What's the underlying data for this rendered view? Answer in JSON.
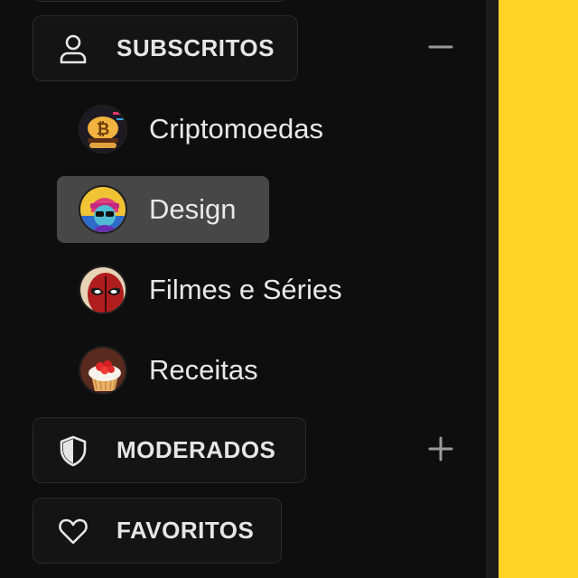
{
  "sections": {
    "subscritos": {
      "label": "SUBSCRITOS",
      "icon": "user-icon",
      "toggle_icon": "minus-icon"
    },
    "moderados": {
      "label": "MODERADOS",
      "icon": "shield-icon",
      "toggle_icon": "plus-icon"
    },
    "favoritos": {
      "label": "FAVORITOS",
      "icon": "heart-icon"
    }
  },
  "subscribed": [
    {
      "label": "Criptomoedas",
      "avatar": "bitcoin-burger-avatar"
    },
    {
      "label": "Design",
      "avatar": "designer-avatar",
      "active": true
    },
    {
      "label": "Filmes e Séries",
      "avatar": "deadpool-avatar"
    },
    {
      "label": "Receitas",
      "avatar": "cupcake-avatar"
    }
  ],
  "colors": {
    "background": "#0e0e0e",
    "button_border": "#2b2b2b",
    "active_item": "#474747",
    "accent_yellow": "#ffd426",
    "text": "#e6e6e6"
  }
}
